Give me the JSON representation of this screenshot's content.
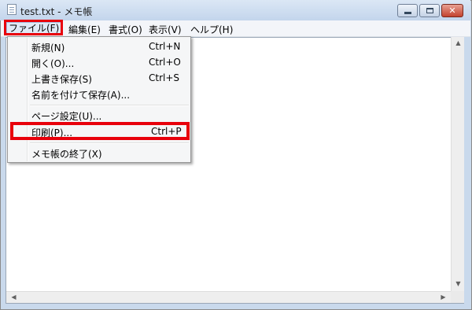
{
  "window": {
    "title": "test.txt - メモ帳",
    "minimize_icon": "minimize-icon",
    "maximize_icon": "maximize-icon",
    "close_icon": "close-icon",
    "close_glyph": "✕"
  },
  "menubar": {
    "items": [
      {
        "label": "ファイル(F)"
      },
      {
        "label": "編集(E)"
      },
      {
        "label": "書式(O)"
      },
      {
        "label": "表示(V)"
      },
      {
        "label": "ヘルプ(H)"
      }
    ]
  },
  "file_menu": {
    "items": [
      {
        "label": "新規(N)",
        "shortcut": "Ctrl+N"
      },
      {
        "label": "開く(O)...",
        "shortcut": "Ctrl+O"
      },
      {
        "label": "上書き保存(S)",
        "shortcut": "Ctrl+S"
      },
      {
        "label": "名前を付けて保存(A)...",
        "shortcut": ""
      },
      {
        "label": "ページ設定(U)...",
        "shortcut": ""
      },
      {
        "label": "印刷(P)...",
        "shortcut": "Ctrl+P"
      },
      {
        "label": "メモ帳の終了(X)",
        "shortcut": ""
      }
    ]
  },
  "scrollbars": {
    "up_arrow": "▲",
    "down_arrow": "▼",
    "left_arrow": "◀",
    "right_arrow": "▶"
  },
  "colors": {
    "highlight": "#e8000b",
    "titlebar": "#c3d5ec",
    "close_button": "#c3422e"
  }
}
